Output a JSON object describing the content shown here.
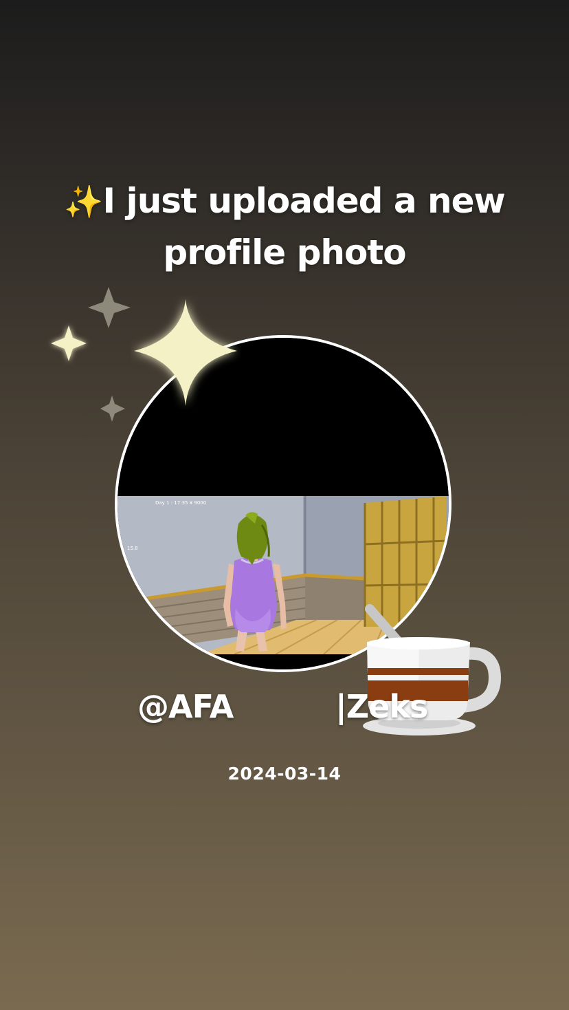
{
  "headline": {
    "emoji": "✨",
    "line1": "I just uploaded a new",
    "line2": "profile photo"
  },
  "photo": {
    "hud_text": "Day 1 : 17:35  ¥ 9000",
    "side_text": "15.8"
  },
  "names": {
    "left": "@AFA",
    "right": "|Zeks"
  },
  "date": "2024-03-14",
  "icons": {
    "sparkles": "sparkles-icon",
    "cup": "coffee-cup-icon"
  },
  "colors": {
    "sparkle": "#f4f1c6",
    "sparkle_dim": "#8d8a7c",
    "cup_stripe": "#8a3d10",
    "swimsuit": "#a878e0",
    "hair": "#6f8a12"
  }
}
